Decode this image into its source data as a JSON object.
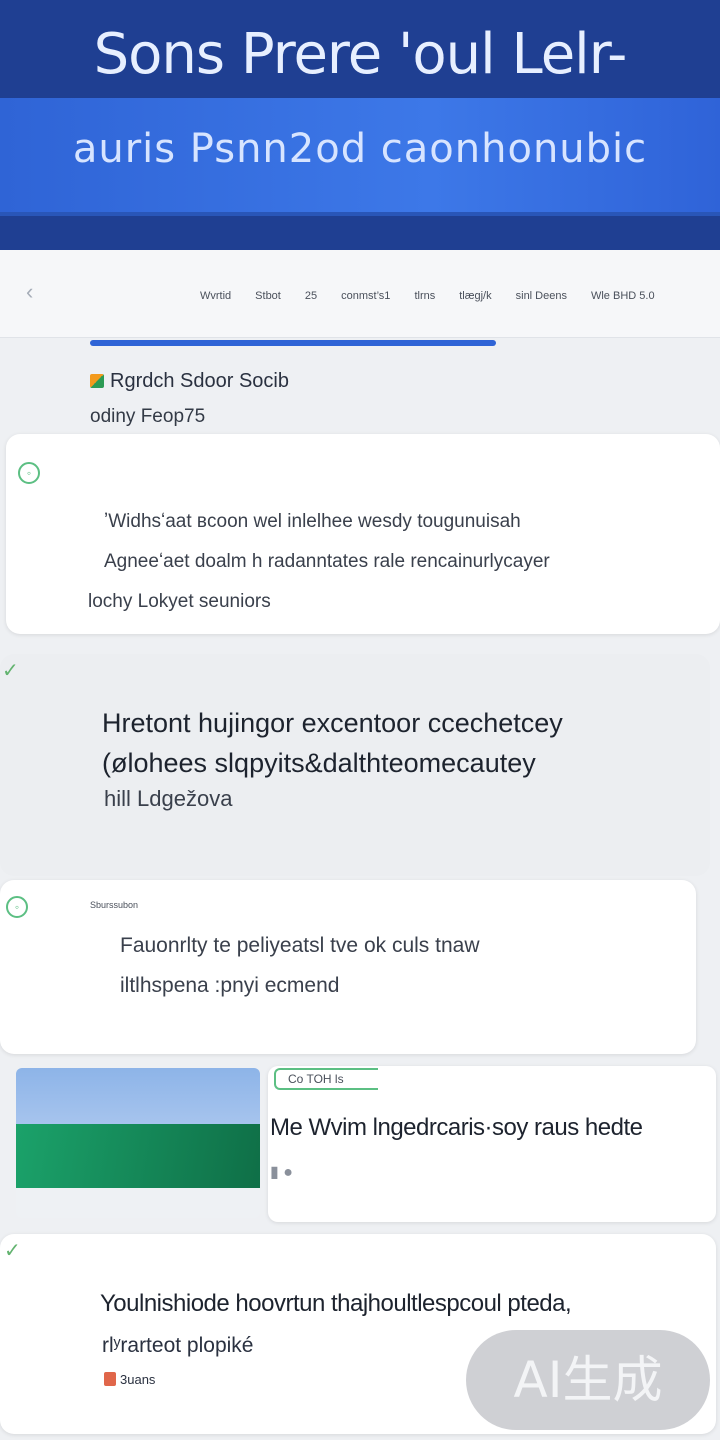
{
  "header": {
    "title": "Sons Prere 'oul Lelr-",
    "subtitle": "auris Psnn2od caonhonubic"
  },
  "nav": {
    "back_icon": "chevron-left-icon",
    "items": [
      "Wvrtid",
      "Stbot",
      "25",
      "conmst’s1",
      "tlrns",
      "tlægj/k",
      "sinl Deens",
      "Wle BHD 5.0"
    ]
  },
  "section": {
    "title": "Rgrdch Sdoor Socib",
    "meta": "odiny Feop75"
  },
  "cards": [
    {
      "icon": "clock-icon",
      "lines": [
        "ʼWidhsʻaat вcoon wel inlelhee wesdy tougunuisah",
        "Agneeʻaet doalm h radanntates rale rencainurlycayer",
        "lochy Lokyet seuniors"
      ]
    },
    {
      "icon": "check-icon",
      "lines": [
        "Hretont hujingor excentoor ccechetcey",
        "(ølohees slqpyits&dalthteomecautey",
        "hill Ldgežova"
      ]
    },
    {
      "icon": "clock-icon",
      "label": "Sburssubon",
      "lines": [
        "Fauonrlty te peliyeatsl tve ok culs tnaw",
        "iltlhspena :pnyi ecmend"
      ]
    }
  ],
  "news": {
    "tag": "Co TOH ls",
    "headline": "Me Wvim lngedrcaris·soy raus hedte",
    "icons": "▮ ●"
  },
  "footer_card": {
    "line1": "Youlnishiode hoovrtun thajhoultlespcoul pteda,",
    "line2": "rlʸrarteot plopiké",
    "badge": "3uans"
  },
  "watermark": "AI生成",
  "colors": {
    "header_dark": "#1f3f92",
    "header_band": "#3d78e8",
    "accent_blue": "#2f64d6",
    "accent_green": "#5cbf83",
    "badge_red": "#e0664a"
  }
}
